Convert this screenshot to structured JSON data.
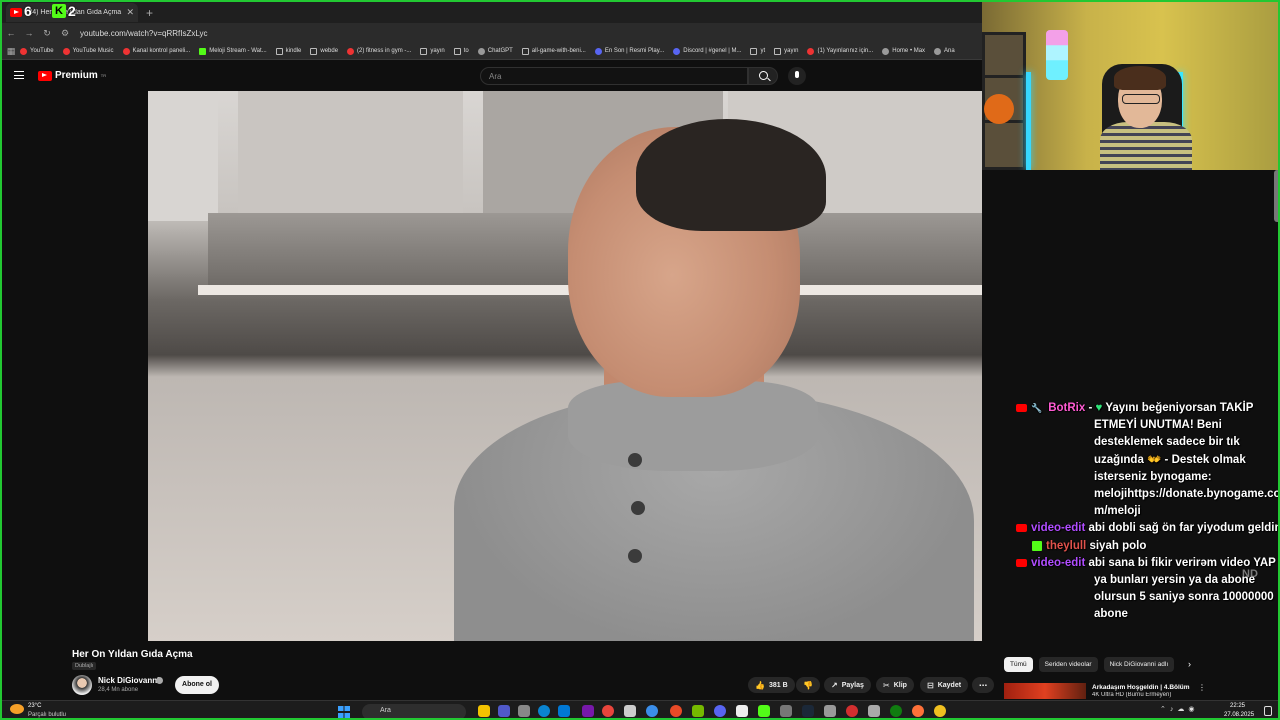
{
  "browser": {
    "tab_title": "(24) Her On Yıldan Gıda Açma",
    "new_tab": "+",
    "url": "youtube.com/watch?v=qRRfIsZxLyc",
    "bookmarks": [
      "YouTube",
      "YouTube Music",
      "Kanal kontrol paneli...",
      "Meloji Stream - Wat...",
      "kindle",
      "webde",
      "(2) fitness in gym -...",
      "yayın",
      "to",
      "ChatGPT",
      "all-game-with-beni...",
      "En Son | Resmi Play...",
      "Discord | #genel | M...",
      "yt",
      "yayın",
      "(1) Yayınlarınız için...",
      "Home • Max",
      "Ana"
    ]
  },
  "overlay": {
    "num1": "6",
    "kick": "K",
    "num2": "2"
  },
  "youtube": {
    "logo": "Premium",
    "logo_region": "TR",
    "search_placeholder": "Ara"
  },
  "video": {
    "title": "Her On Yıldan Gıda Açma",
    "dub_label": "Dublajlı",
    "channel": "Nick DiGiovanni",
    "subscribers": "28,4 Mn abone",
    "subscribe_label": "Abone ol",
    "likes": "381 B",
    "share": "Paylaş",
    "clip": "Klip",
    "save": "Kaydet"
  },
  "sidebar": {
    "chips": [
      "Tümü",
      "Seriden videolar",
      "Nick DiGiovanni adlı"
    ],
    "rec_title": "Arkadaşım Hoşgeldin | 4.Bölüm",
    "rec_sub": "4K Ultra HD (Burnu Ermeyen)"
  },
  "chat": {
    "messages": [
      {
        "user": "BotRix",
        "first": "Yayını beğeniyorsan TAKİP",
        "rest": [
          "ETMEYİ UNUTMA! Beni",
          "desteklemek sadece bir tık",
          "uzağında 👐 - Destek olmak",
          "isterseniz bynogame:",
          "melojihttps://donate.bynogame.co",
          "m/meloji"
        ]
      },
      {
        "user": "video-edit",
        "first": "abi dobli sağ ön far yiyodum geldim",
        "rest": []
      },
      {
        "user": "theylull",
        "first": "siyah polo",
        "rest": []
      },
      {
        "user": "video-edit",
        "first": "abi sana bi fikir verirəm video YAP",
        "rest": [
          "ya bunları yersin ya da abone",
          "olursun 5 saniyə sonra 10000000",
          "abone"
        ]
      }
    ],
    "watermark": "ND"
  },
  "taskbar": {
    "temp": "23°C",
    "weather": "Parçalı bulutlu",
    "search": "Ara",
    "time": "22:25",
    "date": "27.08.2025"
  }
}
